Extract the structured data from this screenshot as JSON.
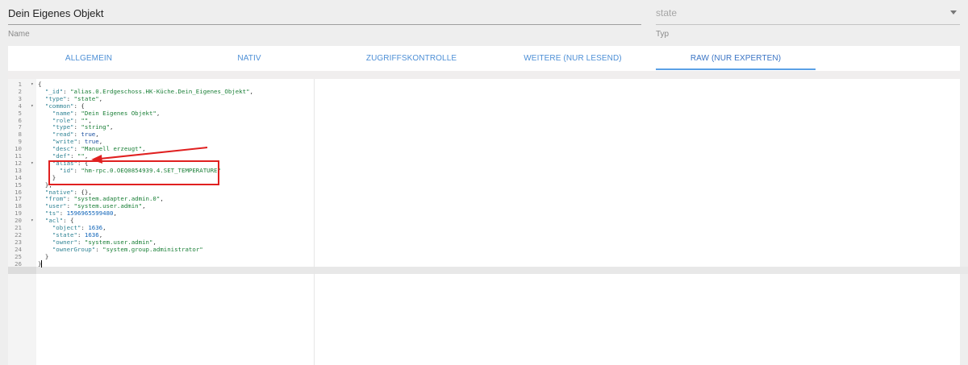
{
  "header": {
    "name_value": "Dein Eigenes Objekt",
    "name_label": "Name",
    "type_value": "state",
    "type_label": "Typ"
  },
  "tabs": [
    {
      "label": "ALLGEMEIN"
    },
    {
      "label": "NATIV"
    },
    {
      "label": "ZUGRIFFSKONTROLLE"
    },
    {
      "label": "WEITERE (NUR LESEND)"
    },
    {
      "label": "RAW (NUR EXPERTEN)"
    }
  ],
  "active_tab": "RAW (NUR EXPERTEN)",
  "colors": {
    "accent": "#5aa0e6",
    "annotation": "#e02020",
    "json_key": "#318495",
    "json_string": "#1a7f37",
    "json_number": "#0e63b8"
  },
  "editor": {
    "active_line": 26,
    "lines": [
      {
        "n": "1",
        "fold": true,
        "parts": [
          [
            "p",
            "{"
          ]
        ]
      },
      {
        "n": "2",
        "parts": [
          [
            "p",
            "  "
          ],
          [
            "k",
            "\"_id\""
          ],
          [
            "p",
            ": "
          ],
          [
            "s",
            "\"alias.0.Erdgeschoss.HK-Küche.Dein_Eigenes_Objekt\""
          ],
          [
            "p",
            ","
          ]
        ]
      },
      {
        "n": "3",
        "parts": [
          [
            "p",
            "  "
          ],
          [
            "k",
            "\"type\""
          ],
          [
            "p",
            ": "
          ],
          [
            "s",
            "\"state\""
          ],
          [
            "p",
            ","
          ]
        ]
      },
      {
        "n": "4",
        "fold": true,
        "parts": [
          [
            "p",
            "  "
          ],
          [
            "k",
            "\"common\""
          ],
          [
            "p",
            ": {"
          ]
        ]
      },
      {
        "n": "5",
        "parts": [
          [
            "p",
            "    "
          ],
          [
            "k",
            "\"name\""
          ],
          [
            "p",
            ": "
          ],
          [
            "s",
            "\"Dein Eigenes Objekt\""
          ],
          [
            "p",
            ","
          ]
        ]
      },
      {
        "n": "6",
        "parts": [
          [
            "p",
            "    "
          ],
          [
            "k",
            "\"role\""
          ],
          [
            "p",
            ": "
          ],
          [
            "s",
            "\"\""
          ],
          [
            "p",
            ","
          ]
        ]
      },
      {
        "n": "7",
        "parts": [
          [
            "p",
            "    "
          ],
          [
            "k",
            "\"type\""
          ],
          [
            "p",
            ": "
          ],
          [
            "s",
            "\"string\""
          ],
          [
            "p",
            ","
          ]
        ]
      },
      {
        "n": "8",
        "parts": [
          [
            "p",
            "    "
          ],
          [
            "k",
            "\"read\""
          ],
          [
            "p",
            ": "
          ],
          [
            "b",
            "true"
          ],
          [
            "p",
            ","
          ]
        ]
      },
      {
        "n": "9",
        "parts": [
          [
            "p",
            "    "
          ],
          [
            "k",
            "\"write\""
          ],
          [
            "p",
            ": "
          ],
          [
            "b",
            "true"
          ],
          [
            "p",
            ","
          ]
        ]
      },
      {
        "n": "10",
        "parts": [
          [
            "p",
            "    "
          ],
          [
            "k",
            "\"desc\""
          ],
          [
            "p",
            ": "
          ],
          [
            "s",
            "\"Manuell erzeugt\""
          ],
          [
            "p",
            ","
          ]
        ]
      },
      {
        "n": "11",
        "parts": [
          [
            "p",
            "    "
          ],
          [
            "k",
            "\"def\""
          ],
          [
            "p",
            ": "
          ],
          [
            "s",
            "\"\""
          ],
          [
            "p",
            ","
          ]
        ]
      },
      {
        "n": "12",
        "fold": true,
        "parts": [
          [
            "p",
            "    "
          ],
          [
            "k",
            "\"alias\""
          ],
          [
            "p",
            ": {"
          ]
        ]
      },
      {
        "n": "13",
        "parts": [
          [
            "p",
            "      "
          ],
          [
            "k",
            "\"id\""
          ],
          [
            "p",
            ": "
          ],
          [
            "s",
            "\"hm-rpc.0.OEQ0854939.4.SET_TEMPERATURE\""
          ]
        ]
      },
      {
        "n": "14",
        "parts": [
          [
            "p",
            "    }"
          ]
        ]
      },
      {
        "n": "15",
        "parts": [
          [
            "p",
            "  },"
          ]
        ]
      },
      {
        "n": "16",
        "parts": [
          [
            "p",
            "  "
          ],
          [
            "k",
            "\"native\""
          ],
          [
            "p",
            ": {},"
          ]
        ]
      },
      {
        "n": "17",
        "parts": [
          [
            "p",
            "  "
          ],
          [
            "k",
            "\"from\""
          ],
          [
            "p",
            ": "
          ],
          [
            "s",
            "\"system.adapter.admin.0\""
          ],
          [
            "p",
            ","
          ]
        ]
      },
      {
        "n": "18",
        "parts": [
          [
            "p",
            "  "
          ],
          [
            "k",
            "\"user\""
          ],
          [
            "p",
            ": "
          ],
          [
            "s",
            "\"system.user.admin\""
          ],
          [
            "p",
            ","
          ]
        ]
      },
      {
        "n": "19",
        "parts": [
          [
            "p",
            "  "
          ],
          [
            "k",
            "\"ts\""
          ],
          [
            "p",
            ": "
          ],
          [
            "n",
            "1596965599480"
          ],
          [
            "p",
            ","
          ]
        ]
      },
      {
        "n": "20",
        "fold": true,
        "parts": [
          [
            "p",
            "  "
          ],
          [
            "k",
            "\"acl\""
          ],
          [
            "p",
            ": {"
          ]
        ]
      },
      {
        "n": "21",
        "parts": [
          [
            "p",
            "    "
          ],
          [
            "k",
            "\"object\""
          ],
          [
            "p",
            ": "
          ],
          [
            "n",
            "1636"
          ],
          [
            "p",
            ","
          ]
        ]
      },
      {
        "n": "22",
        "parts": [
          [
            "p",
            "    "
          ],
          [
            "k",
            "\"state\""
          ],
          [
            "p",
            ": "
          ],
          [
            "n",
            "1636"
          ],
          [
            "p",
            ","
          ]
        ]
      },
      {
        "n": "23",
        "parts": [
          [
            "p",
            "    "
          ],
          [
            "k",
            "\"owner\""
          ],
          [
            "p",
            ": "
          ],
          [
            "s",
            "\"system.user.admin\""
          ],
          [
            "p",
            ","
          ]
        ]
      },
      {
        "n": "24",
        "parts": [
          [
            "p",
            "    "
          ],
          [
            "k",
            "\"ownerGroup\""
          ],
          [
            "p",
            ": "
          ],
          [
            "s",
            "\"system.group.administrator\""
          ]
        ]
      },
      {
        "n": "25",
        "parts": [
          [
            "p",
            "  }"
          ]
        ]
      },
      {
        "n": "26",
        "cursor": true,
        "parts": [
          [
            "p",
            "}"
          ]
        ]
      }
    ]
  }
}
